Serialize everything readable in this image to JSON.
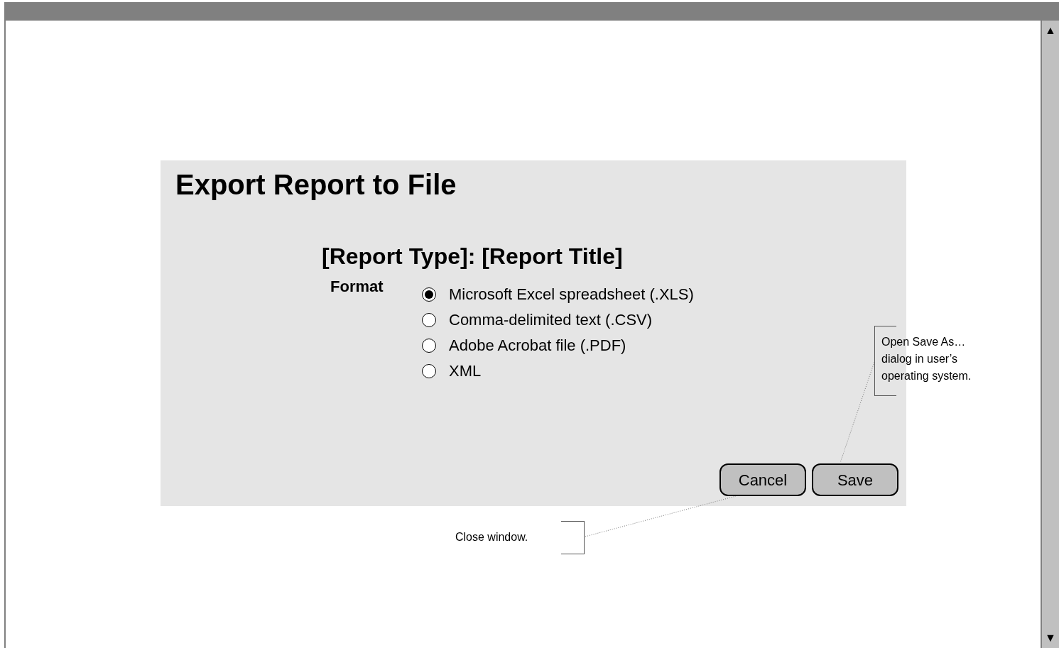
{
  "dialog": {
    "title": "Export Report to File",
    "subtitle": "[Report Type]: [Report Title]",
    "format_label": "Format",
    "options": [
      {
        "label": "Microsoft Excel spreadsheet (.XLS)",
        "selected": true
      },
      {
        "label": "Comma-delimited text (.CSV)",
        "selected": false
      },
      {
        "label": "Adobe Acrobat file (.PDF)",
        "selected": false
      },
      {
        "label": "XML",
        "selected": false
      }
    ],
    "buttons": [
      {
        "label": "Cancel"
      },
      {
        "label": "Save"
      }
    ]
  },
  "annotations": [
    {
      "text": "Open Save As… dialog in user’s operating system."
    },
    {
      "text": "Close window."
    }
  ],
  "scrollbar": {
    "up": "▲",
    "down": "▼"
  }
}
